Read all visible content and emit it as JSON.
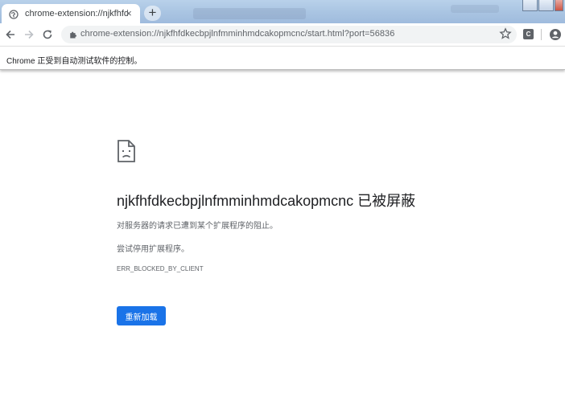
{
  "tab": {
    "title": "chrome-extension://njkfhfdke",
    "close_glyph": "×",
    "new_tab_glyph": "+",
    "favicon": "globe-icon"
  },
  "toolbar": {
    "back_icon": "back-arrow-icon",
    "forward_icon": "forward-arrow-icon",
    "reload_icon": "reload-icon",
    "url": "chrome-extension://njkfhfdkecbpjlnfmminhmdcakopmcnc/start.html?port=56836",
    "url_icon": "puzzle-icon",
    "bookmark_icon": "star-icon",
    "extension_label": "C",
    "profile_icon": "account-icon"
  },
  "infobar": {
    "text": "Chrome 正受到自动测试软件的控制。"
  },
  "error": {
    "icon": "sad-page-icon",
    "title": "njkfhfdkecbpjlnfmminhmdcakopmcnc 已被屏蔽",
    "description": "对服务器的请求已遭到某个扩展程序的阻止。",
    "suggestion": "尝试停用扩展程序。",
    "code": "ERR_BLOCKED_BY_CLIENT",
    "reload_label": "重新加载"
  },
  "colors": {
    "accent": "#1a73e8",
    "tabstrip": "#a9c4e2",
    "omnibox": "#f1f3f4"
  }
}
